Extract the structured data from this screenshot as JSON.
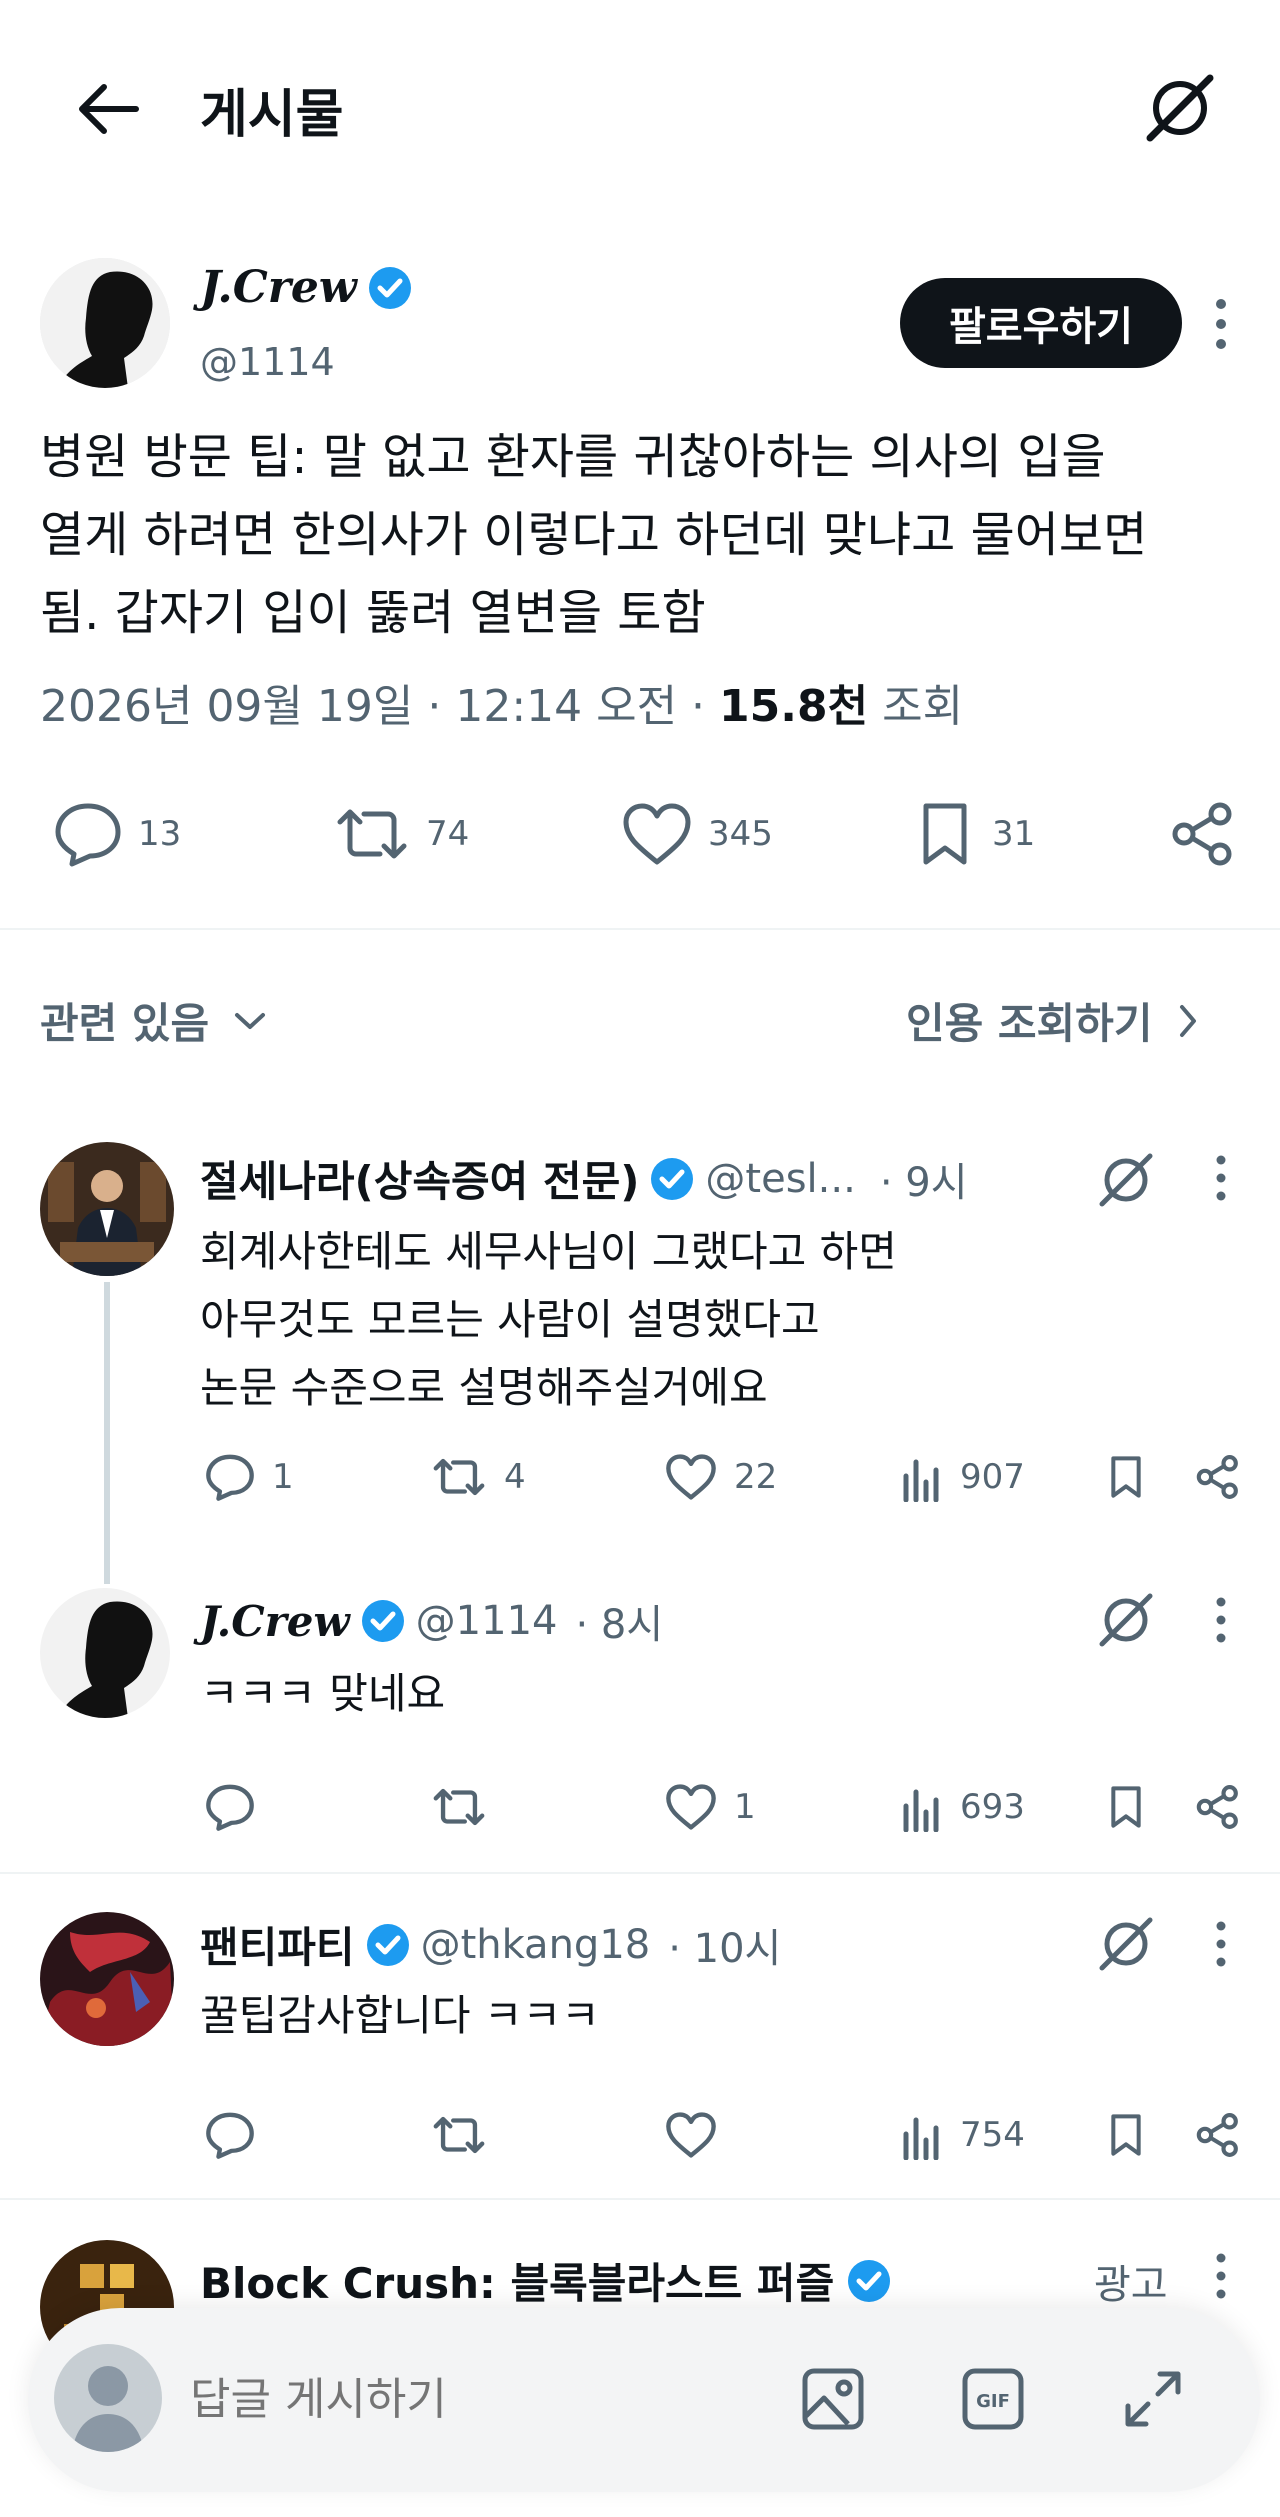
{
  "header": {
    "title": "게시물"
  },
  "post": {
    "author_name": "J.Crew",
    "author_handle": "@1114",
    "follow_label": "팔로우하기",
    "text_line1": "병원 방문 팁: 말 없고 환자를 귀찮아하는 의사의 입을",
    "text_line2": "열게 하려면 한의사가 이렇다고 하던데 맞냐고 물어보면",
    "text_line3": "됨. 갑자기 입이 뚫려 열변을 토함",
    "timestamp": "2026년 09월 19일 · 12:14 오전 ·",
    "views": "15.8천",
    "views_label": "조회",
    "stats": {
      "replies": "13",
      "reposts": "74",
      "likes": "345",
      "bookmarks": "31"
    }
  },
  "related": {
    "label": "관련 있음",
    "quote_label": "인용 조회하기"
  },
  "replies": [
    {
      "name": "절세나라(상속증여 전문)",
      "handle": "@tesl...",
      "time": "· 9시",
      "line1": "회계사한테도 세무사님이 그랬다고 하면",
      "line2": "아무것도 모르는 사람이 설명했다고",
      "line3": "논문 수준으로 설명해주실거에요",
      "replies": "1",
      "reposts": "4",
      "likes": "22",
      "views": "907"
    },
    {
      "name": "J.Crew",
      "handle": "@1114",
      "time": "· 8시",
      "line1": "ㅋㅋㅋ 맞네요",
      "likes": "1",
      "views": "693"
    },
    {
      "name": "팬티파티",
      "handle": "@thkang18",
      "time": "· 10시",
      "line1": "꿀팁감사합니다 ㅋㅋㅋ",
      "views": "754"
    }
  ],
  "ad": {
    "name": "Block Crush: 블록블라스트 퍼즐",
    "label": "광고"
  },
  "composer": {
    "placeholder": "답글 게시하기"
  },
  "colors": {
    "accent": "#1d9bf0",
    "text": "#0f1419",
    "muted": "#536471"
  }
}
